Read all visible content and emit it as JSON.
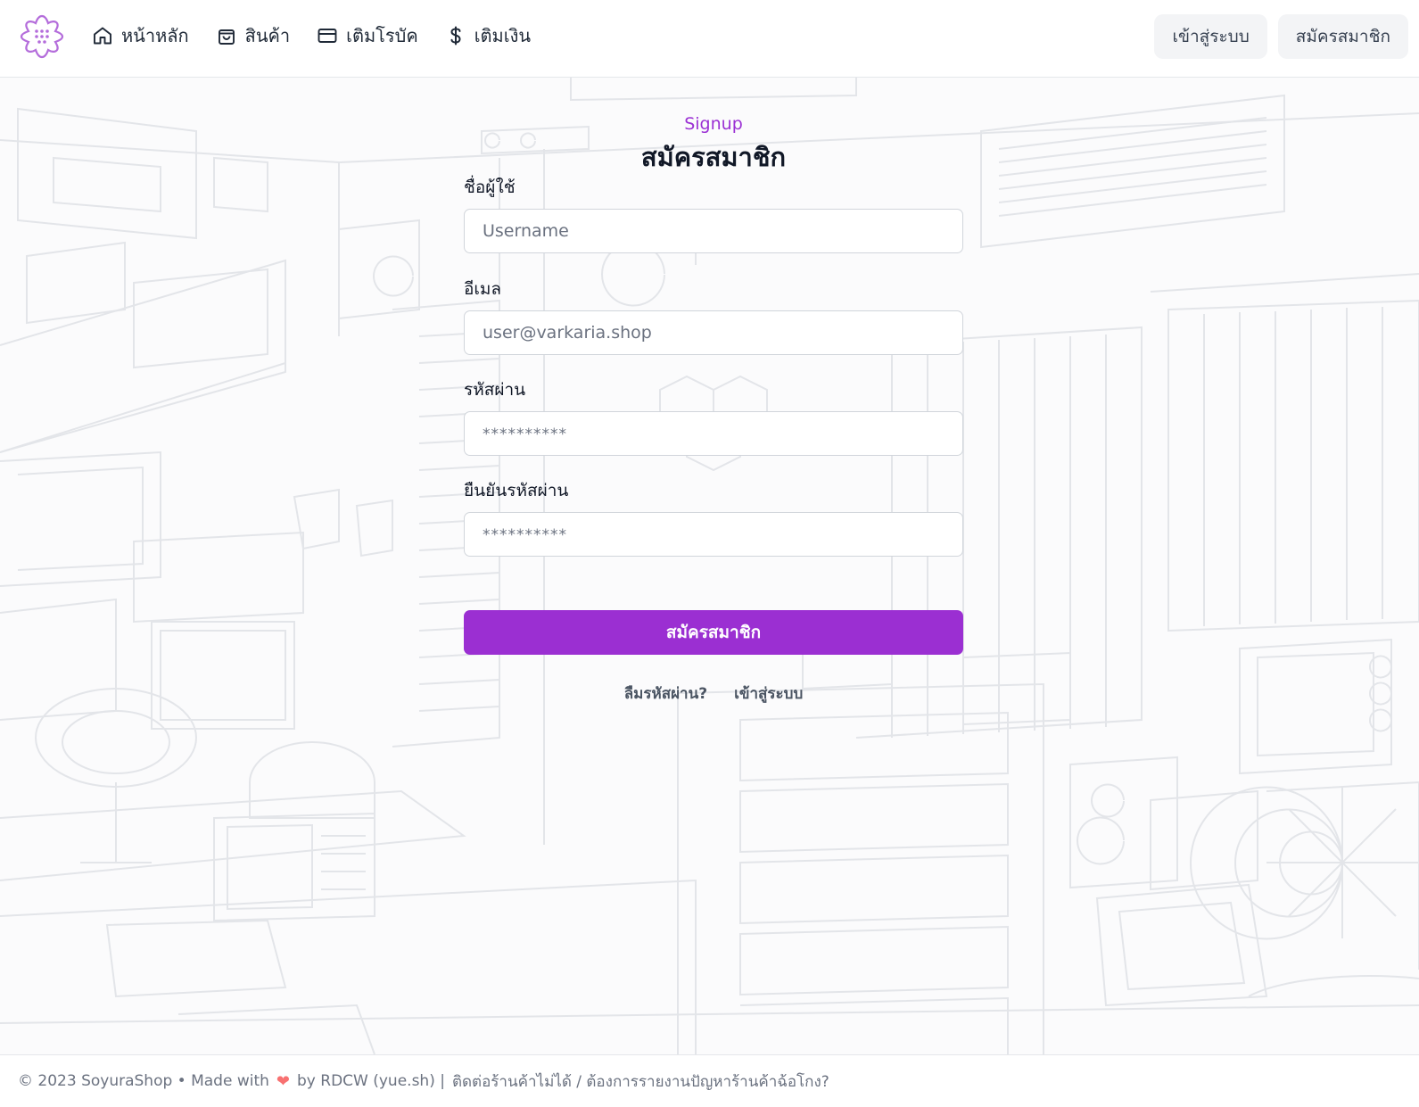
{
  "colors": {
    "accent": "#9b2fd2",
    "eyebrow": "#9b30d4",
    "heart": "#f87171"
  },
  "header": {
    "logo_icon": "flower-icon",
    "nav": [
      {
        "label": "หน้าหลัก",
        "icon": "home-icon"
      },
      {
        "label": "สินค้า",
        "icon": "shopping-bag-icon"
      },
      {
        "label": "เติมโรบัค",
        "icon": "credit-card-icon"
      },
      {
        "label": "เติมเงิน",
        "icon": "dollar-icon"
      }
    ],
    "login_label": "เข้าสู่ระบบ",
    "signup_label": "สมัครสมาชิก"
  },
  "form": {
    "eyebrow": "Signup",
    "title": "สมัครสมาชิก",
    "username": {
      "label": "ชื่อผู้ใช้",
      "value": "",
      "placeholder": "Username"
    },
    "email": {
      "label": "อีเมล",
      "value": "",
      "placeholder": "user@varkaria.shop"
    },
    "password": {
      "label": "รหัสผ่าน",
      "value": "",
      "placeholder": "**********"
    },
    "confirm_password": {
      "label": "ยืนยันรหัสผ่าน",
      "value": "",
      "placeholder": "**********"
    },
    "submit_label": "สมัครสมาชิก",
    "forgot_label": "ลืมรหัสผ่าน?",
    "login_link_label": "เข้าสู่ระบบ"
  },
  "footer": {
    "copyright": "© 2023 SoyuraShop • Made with",
    "heart_icon": "heart-icon",
    "by": "by RDCW (yue.sh) |",
    "report": "ติดต่อร้านค้าไม่ได้ / ต้องการรายงานปัญหาร้านค้าฉ้อโกง?"
  }
}
